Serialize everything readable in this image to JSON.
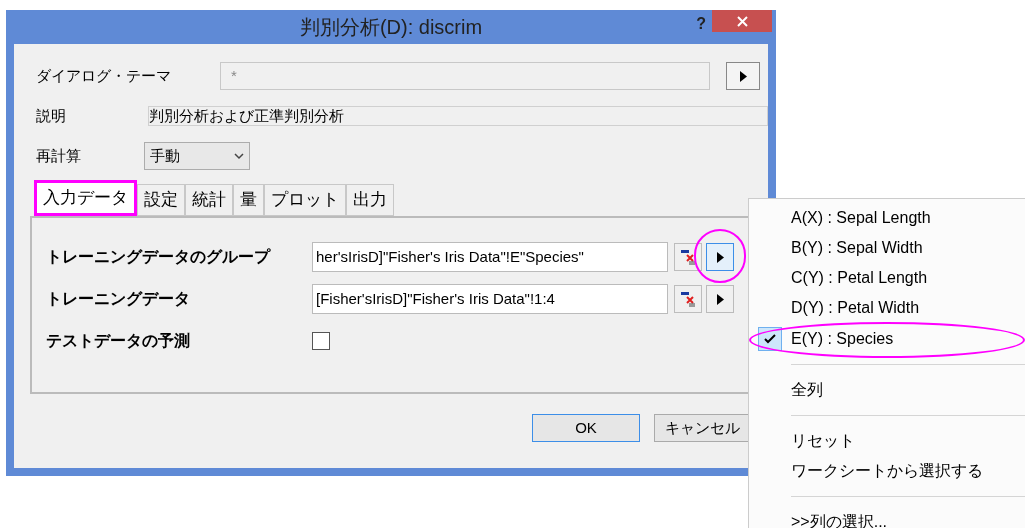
{
  "window": {
    "title": "判別分析(D): discrim",
    "help": "?"
  },
  "theme": {
    "label": "ダイアログ・テーマ",
    "value": "*"
  },
  "description": {
    "label": "説明",
    "value": "判別分析および正準判別分析"
  },
  "recalc": {
    "label": "再計算",
    "value": "手動"
  },
  "tabs": [
    {
      "label": "入力データ",
      "selected": true
    },
    {
      "label": "設定",
      "selected": false
    },
    {
      "label": "統計",
      "selected": false
    },
    {
      "label": "量",
      "selected": false
    },
    {
      "label": "プロット",
      "selected": false
    },
    {
      "label": "出力",
      "selected": false
    }
  ],
  "rows": [
    {
      "kind": "range",
      "label": "トレーニングデータのグループ",
      "value": "her'sIrisD]\"Fisher's Iris Data\"!E\"Species\"",
      "highlighted": true
    },
    {
      "kind": "range",
      "label": "トレーニングデータ",
      "value": "[Fisher'sIrisD]\"Fisher's Iris Data\"!1:4",
      "highlighted": false
    },
    {
      "kind": "checkbox",
      "label": "テストデータの予測",
      "checked": false
    }
  ],
  "buttons": [
    "OK",
    "キャンセル"
  ],
  "menu": [
    {
      "kind": "item",
      "label": "A(X) : Sepal Length",
      "checked": false
    },
    {
      "kind": "item",
      "label": "B(Y) : Sepal Width",
      "checked": false
    },
    {
      "kind": "item",
      "label": "C(Y) : Petal Length",
      "checked": false
    },
    {
      "kind": "item",
      "label": "D(Y) : Petal Width",
      "checked": false
    },
    {
      "kind": "item",
      "label": "E(Y) : Species",
      "checked": true
    },
    {
      "kind": "separator"
    },
    {
      "kind": "item",
      "label": "全列",
      "checked": false
    },
    {
      "kind": "separator"
    },
    {
      "kind": "item",
      "label": "リセット",
      "checked": false
    },
    {
      "kind": "item",
      "label": "ワークシートから選択する",
      "checked": false
    },
    {
      "kind": "separator"
    },
    {
      "kind": "item",
      "label": ">>列の選択...",
      "checked": false
    }
  ]
}
